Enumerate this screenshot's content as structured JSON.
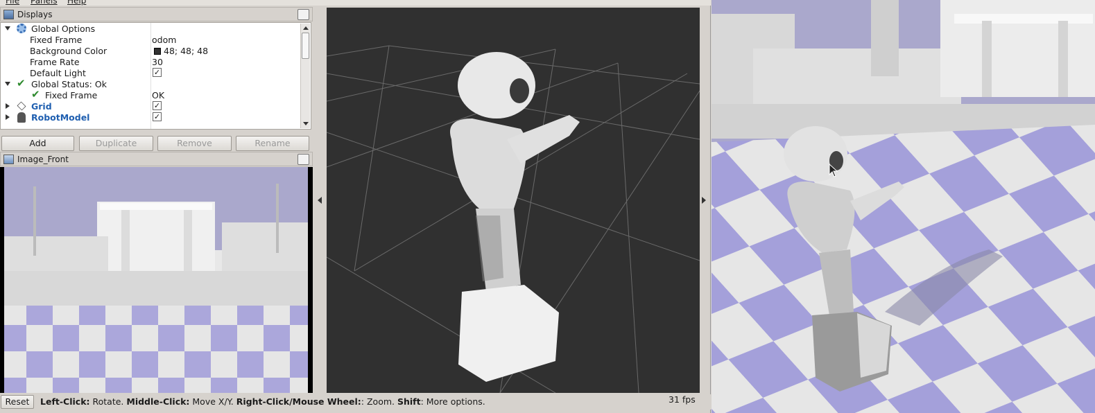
{
  "menubar": {
    "file": "File",
    "panels": "Panels",
    "help": "Help"
  },
  "displays": {
    "title": "Displays",
    "rows": [
      {
        "label": "Global Options",
        "value": ""
      },
      {
        "label": "Fixed Frame",
        "value": "odom"
      },
      {
        "label": "Background Color",
        "value": "48; 48; 48"
      },
      {
        "label": "Frame Rate",
        "value": "30"
      },
      {
        "label": "Default Light",
        "value": ""
      },
      {
        "label": "Global Status: Ok",
        "value": ""
      },
      {
        "label": "Fixed Frame",
        "value": "OK"
      },
      {
        "label": "Grid",
        "value": ""
      },
      {
        "label": "RobotModel",
        "value": ""
      }
    ],
    "checked_mark": "✓",
    "buttons": {
      "add": "Add",
      "duplicate": "Duplicate",
      "remove": "Remove",
      "rename": "Rename"
    }
  },
  "image_panel": {
    "title": "Image_Front"
  },
  "statusbar": {
    "reset": "Reset",
    "hint_parts": [
      {
        "bold": "Left-Click:",
        "text": " Rotate. "
      },
      {
        "bold": "Middle-Click:",
        "text": " Move X/Y. "
      },
      {
        "bold": "Right-Click/Mouse Wheel:",
        "text": ": Zoom. "
      },
      {
        "bold": "Shift",
        "text": ": More options."
      }
    ],
    "fps": "31 fps"
  },
  "colors": {
    "background_3d": "#303030",
    "sky": "#aaa8cc",
    "checker_light": "#e6e6e6",
    "checker_purple": "#a4a0da",
    "status_ok": "#2e8a2e",
    "link_blue": "#1f5fb0"
  },
  "icons": [
    "displays-icon",
    "gear-icon",
    "green-check-icon",
    "grid-icon",
    "robot-icon",
    "image-icon",
    "mouse-cursor-icon"
  ]
}
